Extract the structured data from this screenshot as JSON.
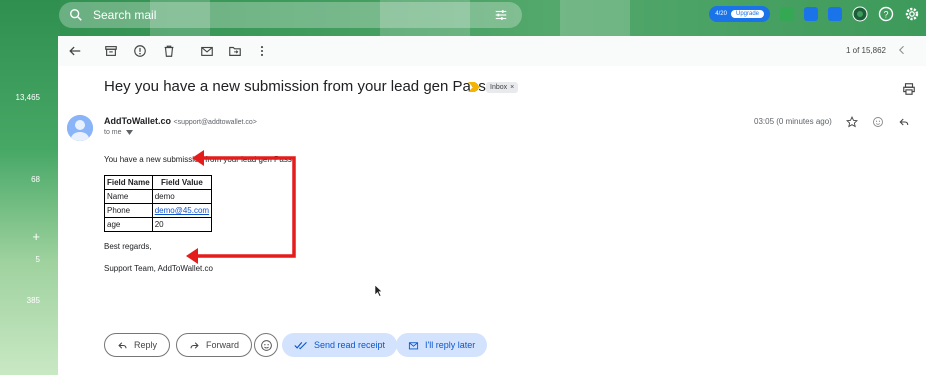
{
  "search": {
    "placeholder": "Search mail"
  },
  "top_right": {
    "meet_count": "4/20",
    "upgrade_label": "Upgrade"
  },
  "left_counts": [
    "13,465",
    "68",
    "5",
    "385"
  ],
  "left_plus": "+",
  "toolbar": {
    "pager": "1 of 15,862"
  },
  "email": {
    "subject": "Hey you have a new submission from your lead gen Pass",
    "label": "Inbox",
    "label_close": "×",
    "sender_name": "AddToWallet.co",
    "sender_email": "<support@addtowallet.co>",
    "to": "to me",
    "time": "03:05 (0 minutes ago)",
    "intro": "You have a new submission from your lead gen Pass",
    "table": {
      "headers": [
        "Field Name",
        "Field Value"
      ],
      "rows": [
        [
          "Name",
          "demo"
        ],
        [
          "Phone",
          "demo@45.com"
        ],
        [
          "age",
          "20"
        ]
      ]
    },
    "regards": "Best regards,",
    "signature": "Support Team, AddToWallet.co"
  },
  "actions": {
    "reply": "Reply",
    "forward": "Forward",
    "send_receipt": "Send read receipt",
    "reply_later": "I'll reply later"
  },
  "colors": {
    "accent": "#1a73e8",
    "annotation_arrow": "#e51c1c",
    "theme_green": "#3d9a5a"
  }
}
